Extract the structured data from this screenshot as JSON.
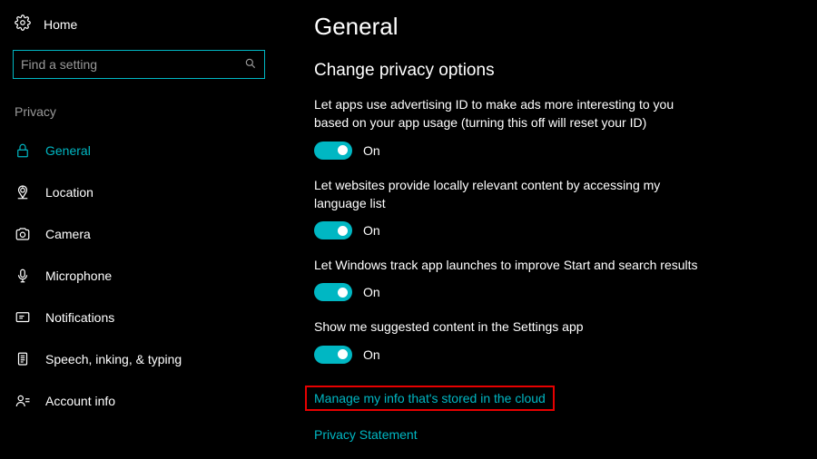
{
  "sidebar": {
    "home_label": "Home",
    "search_placeholder": "Find a setting",
    "section_title": "Privacy",
    "items": [
      {
        "label": "General"
      },
      {
        "label": "Location"
      },
      {
        "label": "Camera"
      },
      {
        "label": "Microphone"
      },
      {
        "label": "Notifications"
      },
      {
        "label": "Speech, inking, & typing"
      },
      {
        "label": "Account info"
      }
    ]
  },
  "main": {
    "title": "General",
    "section_heading": "Change privacy options",
    "options": [
      {
        "desc": "Let apps use advertising ID to make ads more interesting to you based on your app usage (turning this off will reset your ID)",
        "state": "On"
      },
      {
        "desc": "Let websites provide locally relevant content by accessing my language list",
        "state": "On"
      },
      {
        "desc": "Let Windows track app launches to improve Start and search results",
        "state": "On"
      },
      {
        "desc": "Show me suggested content in the Settings app",
        "state": "On"
      }
    ],
    "links": [
      "Manage my info that's stored in the cloud",
      "Privacy Statement"
    ]
  },
  "colors": {
    "accent": "#00b7c3",
    "highlight_border": "#e60000"
  }
}
